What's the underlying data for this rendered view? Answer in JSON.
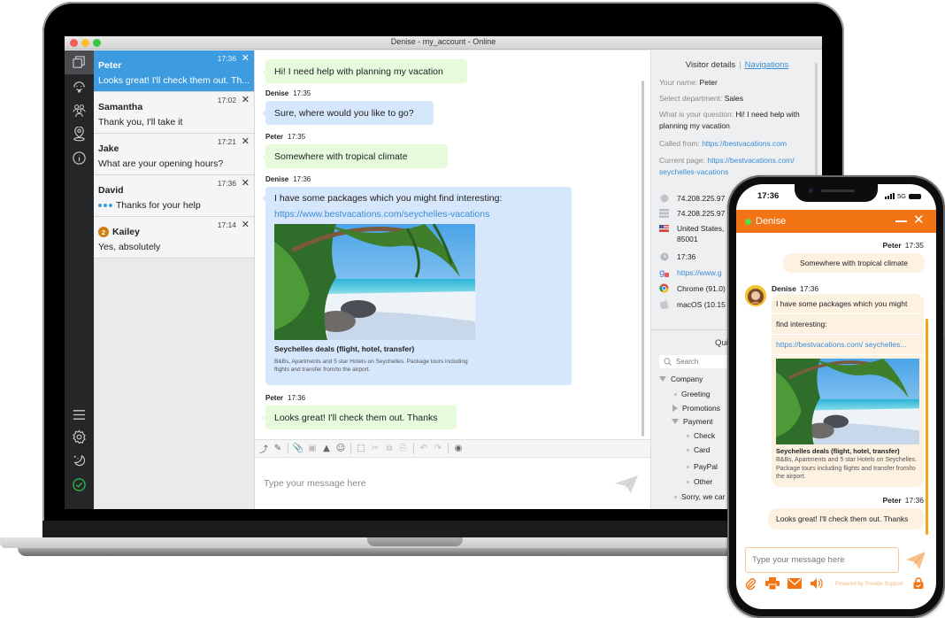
{
  "desktop": {
    "window_title": "Denise - my_account - Online",
    "rail": {
      "top_icons": [
        "chats-icon",
        "operator-icon",
        "visitors-icon",
        "location-icon",
        "info-icon"
      ],
      "bottom_icons": [
        "menu-icon",
        "gear-icon",
        "moon-icon",
        "status-online-icon"
      ]
    },
    "chats": [
      {
        "name": "Peter",
        "time": "17:36",
        "preview": "Looks great! I'll check them out. Th...",
        "active": true
      },
      {
        "name": "Samantha",
        "time": "17:02",
        "preview": "Thank you, I'll take it"
      },
      {
        "name": "Jake",
        "time": "17:21",
        "preview": "What are your opening hours?"
      },
      {
        "name": "David",
        "time": "17:36",
        "preview": "Thanks for your help",
        "typing": true
      },
      {
        "name": "Kailey",
        "time": "17:14",
        "preview": "Yes, absolutely",
        "badge": "2"
      }
    ],
    "conversation": {
      "messages": [
        {
          "type": "visitor",
          "text": "Hi! I need help with planning my vacation"
        },
        {
          "author": "Denise",
          "time": "17:35",
          "type": "agent",
          "text": "Sure, where would you like to go?"
        },
        {
          "author": "Peter",
          "time": "17:35",
          "type": "visitor",
          "text": "Somewhere with tropical climate"
        },
        {
          "author": "Denise",
          "time": "17:36",
          "type": "agent",
          "text": "I have some packages which you might find interesting:",
          "link": "https://www.bestvacations.com/seychelles-vacations",
          "card_title": "Seychelles deals (flight, hotel, transfer)",
          "card_desc": "B&Bs, Apartments and 5 star Hotels on Seychelles. Package tours including flights and transfer from/to the airport."
        },
        {
          "author": "Peter",
          "time": "17:36",
          "type": "visitor",
          "text": "Looks great! I'll check them out. Thanks"
        }
      ],
      "toolbar_icons": [
        "push-page-icon",
        "invite-icon",
        "attach-icon",
        "screenshot-icon",
        "image-icon",
        "emoji-icon",
        "select-icon",
        "cut-icon",
        "copy-icon",
        "paste-icon",
        "undo-icon",
        "redo-icon",
        "spy-icon"
      ],
      "compose_placeholder": "Type your message here"
    },
    "visitor_details": {
      "tab_active": "Visitor details",
      "tab_other": "Navigations",
      "fields": [
        {
          "label": "Your name:",
          "value": "Peter"
        },
        {
          "label": "Select department:",
          "value": "Sales"
        },
        {
          "label": "What is your question:",
          "value": "Hi! I need help with planning my vacation"
        },
        {
          "label": "Called from:",
          "value": "https://bestvacations.com",
          "link": true
        },
        {
          "label": "Current page:",
          "value": "https://bestvacations.com/ seychelles-vacations",
          "link": true
        }
      ],
      "geo": [
        {
          "icon": "ip-icon",
          "value": "74.208.225.97"
        },
        {
          "icon": "host-icon",
          "value": "74.208.225.97"
        },
        {
          "icon": "us-flag-icon",
          "value": "United States, 85001"
        },
        {
          "icon": "clock-icon",
          "value": "17:36"
        },
        {
          "icon": "google-referrer-icon",
          "value": "https://www.g",
          "link": true
        },
        {
          "icon": "chrome-icon",
          "value": "Chrome (91.0)"
        },
        {
          "icon": "apple-icon",
          "value": "macOS (10.15"
        }
      ],
      "quick_title": "Qui",
      "search_placeholder": "Search",
      "tree": [
        {
          "label": "Company",
          "level": 0,
          "type": "open"
        },
        {
          "label": "Greeting",
          "level": 1,
          "type": "leaf"
        },
        {
          "label": "Promotions",
          "level": 1,
          "type": "closed"
        },
        {
          "label": "Payment",
          "level": 1,
          "type": "open"
        },
        {
          "label": "Check",
          "level": 2,
          "type": "leaf"
        },
        {
          "label": "Card",
          "level": 2,
          "type": "leaf"
        },
        {
          "label": "PayPal",
          "level": 2,
          "type": "leaf"
        },
        {
          "label": "Other",
          "level": 2,
          "type": "leaf"
        },
        {
          "label": "Sorry, we car",
          "level": 1,
          "type": "leaf"
        }
      ]
    }
  },
  "phone": {
    "status_time": "17:36",
    "network": "5G",
    "agent_name": "Denise",
    "messages": [
      {
        "author": "Peter",
        "time": "17:35",
        "text": "Somewhere with tropical climate"
      },
      {
        "author": "Denise",
        "time": "17:36",
        "text_line1": "I have some packages which you might",
        "text_line2": "find interesting:",
        "link": "https://bestvacations.com/ seychelles...",
        "card_title": "Seychelles deals (flight, hotel, transfer)",
        "card_desc": "B&Bs, Apartments and 5 star Hotels on Seychelles. Package tours including flights and transfer from/to the airport."
      },
      {
        "author": "Peter",
        "time": "17:36",
        "text": "Looks great! I'll check them out. Thanks"
      }
    ],
    "input_placeholder": "Type your message here",
    "powered_by": "Powered by Provide Support",
    "accent_color": "#f27414"
  }
}
